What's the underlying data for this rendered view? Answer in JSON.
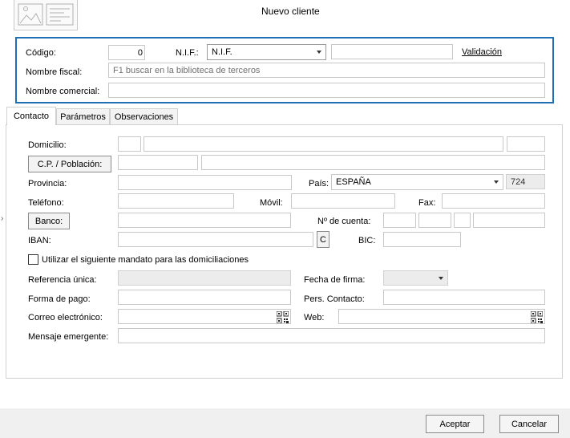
{
  "window": {
    "title": "Nuevo cliente"
  },
  "header": {
    "codigo_label": "Código:",
    "codigo_value": "0",
    "nif_label": "N.I.F.:",
    "nif_type": "N.I.F.",
    "nif_value": "",
    "validacion_link": "Validación",
    "nombre_fiscal_label": "Nombre fiscal:",
    "nombre_fiscal_placeholder": "F1 buscar en la biblioteca de terceros",
    "nombre_comercial_label": "Nombre comercial:"
  },
  "tabs": [
    {
      "label": "Contacto",
      "active": true
    },
    {
      "label": "Parámetros",
      "active": false
    },
    {
      "label": "Observaciones",
      "active": false
    }
  ],
  "contacto": {
    "domicilio_label": "Domicilio:",
    "cp_button": "C.P. / Población:",
    "provincia_label": "Provincia:",
    "pais_label": "País:",
    "pais_value": "ESPAÑA",
    "pais_code": "724",
    "telefono_label": "Teléfono:",
    "movil_label": "Móvil:",
    "fax_label": "Fax:",
    "banco_button": "Banco:",
    "cuenta_label": "Nº de cuenta:",
    "iban_label": "IBAN:",
    "iban_button": "C",
    "bic_label": "BIC:",
    "mandato_checkbox": "Utilizar el siguiente mandato para las domiciliaciones",
    "referencia_label": "Referencia única:",
    "fecha_firma_label": "Fecha de firma:",
    "forma_pago_label": "Forma de pago:",
    "pers_contacto_label": "Pers. Contacto:",
    "correo_label": "Correo electrónico:",
    "web_label": "Web:",
    "mensaje_label": "Mensaje emergente:"
  },
  "footer": {
    "aceptar": "Aceptar",
    "cancelar": "Cancelar"
  },
  "colors": {
    "accent_border": "#1f6fb5",
    "footer_bg": "#f0f0f0"
  }
}
